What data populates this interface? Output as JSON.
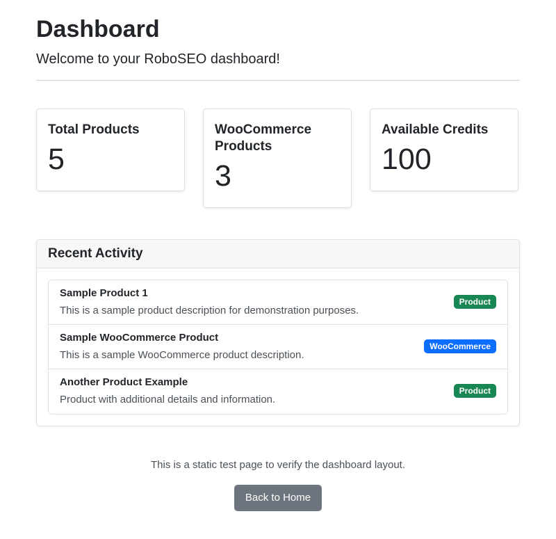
{
  "header": {
    "title": "Dashboard",
    "subtitle": "Welcome to your RoboSEO dashboard!"
  },
  "stats": [
    {
      "label": "Total Products",
      "value": "5"
    },
    {
      "label": "WooCommerce Products",
      "value": "3"
    },
    {
      "label": "Available Credits",
      "value": "100"
    }
  ],
  "activity": {
    "title": "Recent Activity",
    "items": [
      {
        "title": "Sample Product 1",
        "description": "This is a sample product description for demonstration purposes.",
        "badge": "Product"
      },
      {
        "title": "Sample WooCommerce Product",
        "description": "This is a sample WooCommerce product description.",
        "badge": "WooCommerce"
      },
      {
        "title": "Another Product Example",
        "description": "Product with additional details and information.",
        "badge": "Product"
      }
    ]
  },
  "footer": {
    "note": "This is a static test page to verify the dashboard layout.",
    "back_button": "Back to Home"
  },
  "colors": {
    "badge_product": "#198754",
    "badge_woocommerce": "#0d6efd",
    "button_secondary": "#6c757d"
  }
}
